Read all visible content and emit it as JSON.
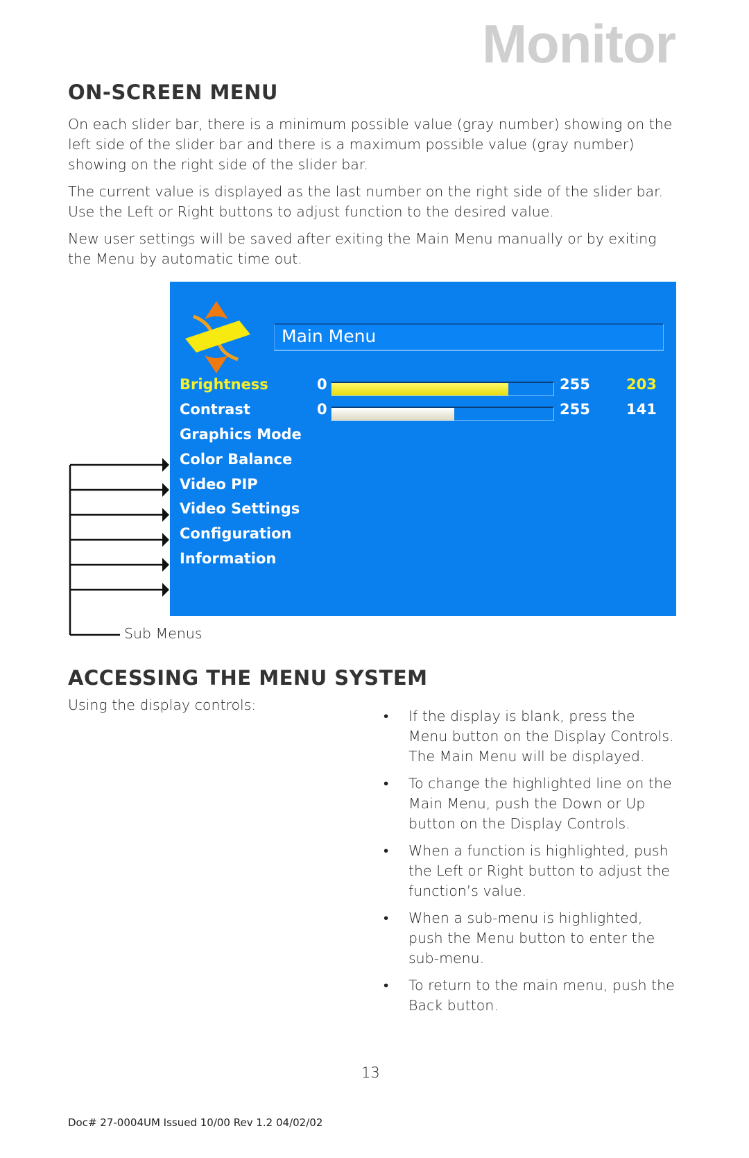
{
  "header": {
    "brand": "Monitor"
  },
  "section1": {
    "title": "ON-SCREEN MENU",
    "paragraphs": [
      "On each slider bar, there is a minimum possible value (gray number) showing on the left side of the slider bar and there is a maximum possible value (gray number) showing on the right side of the slider bar.",
      "The current value is displayed as the last number on the right side of the slider bar.  Use the Left or Right buttons to adjust function to the desired value.",
      "New user settings will be saved after exiting the Main Menu manually or by exiting the Menu by automatic time out."
    ]
  },
  "osd": {
    "title": "Main Menu",
    "colors": {
      "background": "#0a7fee",
      "highlight": "#f4f02a",
      "text": "#ffffff"
    },
    "sliders": [
      {
        "label": "Brightness",
        "min": "0",
        "max": "255",
        "value": "203",
        "fraction": 0.796,
        "selected": true
      },
      {
        "label": "Contrast",
        "min": "0",
        "max": "255",
        "value": "141",
        "fraction": 0.553,
        "selected": false
      }
    ],
    "submenus": [
      "Graphics Mode",
      "Color Balance",
      "Video PIP",
      "Video Settings",
      "Configuration",
      "Information"
    ],
    "annotation": "Sub Menus"
  },
  "section2": {
    "title": "ACCESSING THE MENU SYSTEM",
    "intro": "Using the display controls:",
    "bullet_glyph": "•",
    "bullets": [
      "If the display is blank, press the Menu button on the Display Controls.  The Main Menu will be displayed.",
      "To change the highlighted line on the Main Menu, push the Down or Up button on the Display Controls.",
      "When a function is highlighted, push the Left or Right button to adjust the function’s value.",
      "When a sub-menu is highlighted, push the Menu button to enter the sub-menu.",
      "To return to the main menu, push the Back button."
    ]
  },
  "footer": {
    "page_number": "13",
    "doc_info": "Doc# 27-0004UM  Issued 10/00  Rev 1.2 04/02/02"
  }
}
